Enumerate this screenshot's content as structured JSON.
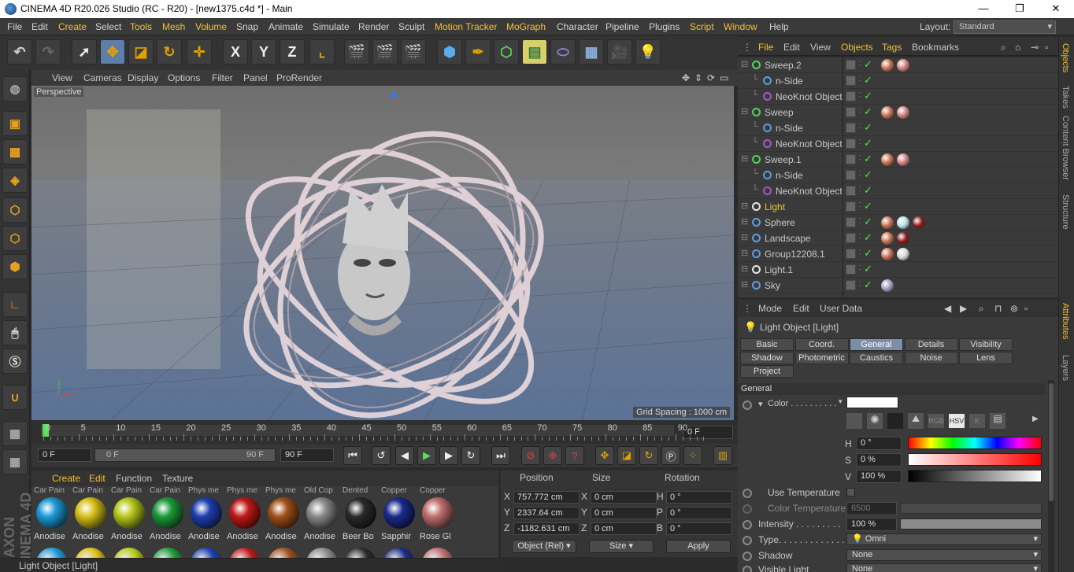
{
  "window": {
    "title": "CINEMA 4D R20.026 Studio (RC - R20) - [new1375.c4d *] - Main",
    "minimize": "—",
    "restore": "❐",
    "close": "✕"
  },
  "menubar": {
    "items": [
      "File",
      "Edit",
      "Create",
      "Select",
      "Tools",
      "Mesh",
      "Volume",
      "Snap",
      "Animate",
      "Simulate",
      "Render",
      "Sculpt",
      "Motion Tracker",
      "MoGraph",
      "Character",
      "Pipeline",
      "Plugins",
      "Script",
      "Window",
      "Help"
    ],
    "layout_label": "Layout:",
    "layout_value": "Standard"
  },
  "toolbar": {
    "axis_x": "X",
    "axis_y": "Y",
    "axis_z": "Z"
  },
  "viewport": {
    "menu": [
      "View",
      "Cameras",
      "Display",
      "Options",
      "Filter",
      "Panel",
      "ProRender"
    ],
    "camera_label": "Perspective",
    "grid_spacing": "Grid Spacing : 1000 cm"
  },
  "timeline": {
    "ticks": [
      "0",
      "5",
      "10",
      "15",
      "20",
      "25",
      "30",
      "35",
      "40",
      "45",
      "50",
      "55",
      "60",
      "65",
      "70",
      "75",
      "80",
      "85",
      "90"
    ],
    "current_frame": "0 F",
    "start_field": "0 F",
    "range_start": "0 F",
    "range_end": "90 F",
    "end_field": "90 F"
  },
  "materials": {
    "menu": [
      "Create",
      "Edit",
      "Function",
      "Texture"
    ],
    "row1": [
      {
        "label": "Anodise",
        "top": "Car Pain",
        "color": "#1e9ad6"
      },
      {
        "label": "Anodise",
        "top": "Car Pain",
        "color": "#d8c21a"
      },
      {
        "label": "Anodise",
        "top": "Car Pain",
        "color": "#b8c81c"
      },
      {
        "label": "Anodise",
        "top": "Car Pain",
        "color": "#1c9a3a"
      },
      {
        "label": "Anodise",
        "top": "Phys me",
        "color": "#1d3fb0"
      },
      {
        "label": "Anodise",
        "top": "Phys me",
        "color": "#c01818"
      },
      {
        "label": "Anodise",
        "top": "Phys me",
        "color": "#a0501a"
      },
      {
        "label": "Anodise",
        "top": "Old Cop",
        "color": "#8a8a8a"
      },
      {
        "label": "Beer Bo",
        "top": "Dented",
        "color": "#2a2a2a"
      },
      {
        "label": "Sapphir",
        "top": "Copper",
        "color": "#1a2a8a"
      },
      {
        "label": "Rose Gl",
        "top": "Copper",
        "color": "#c07070"
      }
    ]
  },
  "coordinates": {
    "headers": [
      "Position",
      "Size",
      "Rotation"
    ],
    "rows": [
      {
        "axis": "X",
        "pos": "757.772 cm",
        "size_axis": "X",
        "size": "0 cm",
        "rot_axis": "H",
        "rot": "0 °"
      },
      {
        "axis": "Y",
        "pos": "2337.64 cm",
        "size_axis": "Y",
        "size": "0 cm",
        "rot_axis": "P",
        "rot": "0 °"
      },
      {
        "axis": "Z",
        "pos": "-1182.631 cm",
        "size_axis": "Z",
        "size": "0 cm",
        "rot_axis": "B",
        "rot": "0 °"
      }
    ],
    "mode_dropdown": "Object (Rel)",
    "size_dropdown": "Size",
    "apply": "Apply"
  },
  "status": {
    "text": "Light Object [Light]"
  },
  "object_manager": {
    "menu": [
      "File",
      "Edit",
      "View",
      "Objects",
      "Tags",
      "Bookmarks"
    ],
    "objects": [
      {
        "name": "Sweep.2",
        "indent": 0,
        "icon_color": "#5ad05a",
        "tags": [
          "#c87050",
          "#d08080"
        ],
        "highlight": false
      },
      {
        "name": "n-Side",
        "indent": 1,
        "icon_color": "#5a9ee0",
        "tags": [],
        "highlight": false
      },
      {
        "name": "NeoKnot Object",
        "indent": 1,
        "icon_color": "#9a5ad0",
        "tags": [],
        "highlight": false
      },
      {
        "name": "Sweep",
        "indent": 0,
        "icon_color": "#5ad05a",
        "tags": [
          "#c87050",
          "#d08080"
        ],
        "highlight": false
      },
      {
        "name": "n-Side",
        "indent": 1,
        "icon_color": "#5a9ee0",
        "tags": [],
        "highlight": false
      },
      {
        "name": "NeoKnot Object",
        "indent": 1,
        "icon_color": "#9a5ad0",
        "tags": [],
        "highlight": false
      },
      {
        "name": "Sweep.1",
        "indent": 0,
        "icon_color": "#5ad05a",
        "tags": [
          "#c87050",
          "#d08080"
        ],
        "highlight": false
      },
      {
        "name": "n-Side",
        "indent": 1,
        "icon_color": "#5a9ee0",
        "tags": [],
        "highlight": false
      },
      {
        "name": "NeoKnot Object",
        "indent": 1,
        "icon_color": "#9a5ad0",
        "tags": [],
        "highlight": false
      },
      {
        "name": "Light",
        "indent": 0,
        "icon_color": "#e8e8e8",
        "tags": [],
        "highlight": true
      },
      {
        "name": "Sphere",
        "indent": 0,
        "icon_color": "#5a9ee0",
        "tags": [
          "#c87050",
          "#b8e0e8",
          "#8a1a1a"
        ],
        "highlight": false
      },
      {
        "name": "Landscape",
        "indent": 0,
        "icon_color": "#5a9ee0",
        "tags": [
          "#c87050",
          "#8a1a1a"
        ],
        "highlight": false
      },
      {
        "name": "Group12208.1",
        "indent": 0,
        "icon_color": "#5a9ee0",
        "tags": [
          "#c87050",
          "#d8d8d8"
        ],
        "highlight": false
      },
      {
        "name": "Light.1",
        "indent": 0,
        "icon_color": "#e8e8e8",
        "tags": [],
        "highlight": false
      },
      {
        "name": "Sky",
        "indent": 0,
        "icon_color": "#5a9ee0",
        "tags": [
          "#a0a0c0"
        ],
        "highlight": false
      }
    ]
  },
  "right_tabs": [
    "Objects",
    "Takes",
    "Content Browser",
    "Structure",
    "Attributes",
    "Layers"
  ],
  "attributes": {
    "menu": [
      "Mode",
      "Edit",
      "User Data"
    ],
    "object_title": "Light Object [Light]",
    "tabs": [
      "Basic",
      "Coord.",
      "General",
      "Details",
      "Visibility",
      "Shadow",
      "Photometric",
      "Caustics",
      "Noise",
      "Lens",
      "Project"
    ],
    "active_tab": "General",
    "section": "General",
    "color_label": "Color . . . . . . . . . .",
    "color_modes": [
      "RGB",
      "HSV",
      "K"
    ],
    "h_label": "H",
    "h_value": "0 °",
    "s_label": "S",
    "s_value": "0 %",
    "v_label": "V",
    "v_value": "100 %",
    "use_temp_label": "Use Temperature",
    "color_temp_label": "Color Temperature",
    "color_temp_value": "6500",
    "intensity_label": "Intensity . . . . . . . . .",
    "intensity_value": "100 %",
    "type_label": "Type. . . . . . . . . . . . .",
    "type_value": "Omni",
    "shadow_label": "Shadow",
    "shadow_value": "None",
    "visible_label": "Visible Light",
    "visible_value": "None"
  }
}
